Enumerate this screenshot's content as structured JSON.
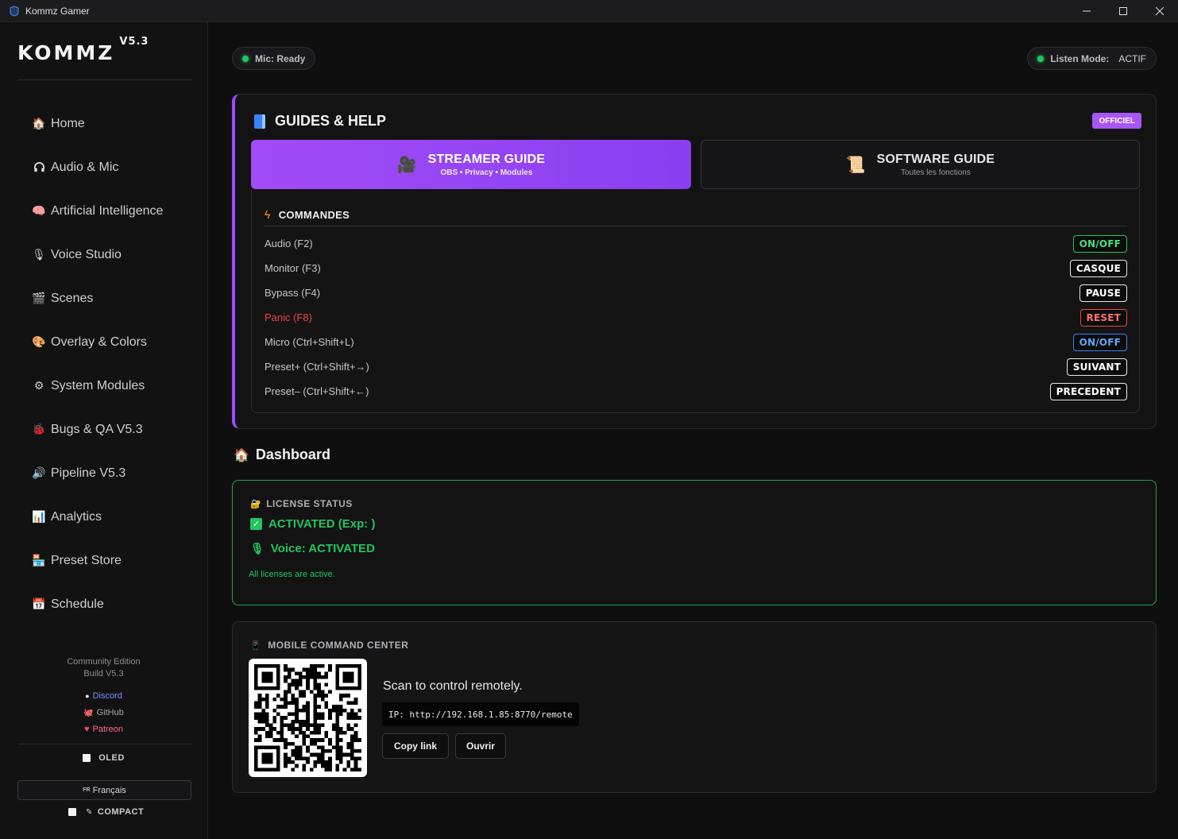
{
  "window": {
    "title": "Kommz Gamer",
    "controls": [
      "minimize",
      "maximize",
      "close"
    ]
  },
  "sidebar": {
    "brand": "KOMMZ",
    "version": "V5.3",
    "items": [
      {
        "label": "Home",
        "icon": "house-icon"
      },
      {
        "label": "Audio & Mic",
        "icon": "headphones-icon"
      },
      {
        "label": "Artificial Intelligence",
        "icon": "brain-icon"
      },
      {
        "label": "Voice Studio",
        "icon": "microphone-icon"
      },
      {
        "label": "Scenes",
        "icon": "clapperboard-icon"
      },
      {
        "label": "Overlay & Colors",
        "icon": "palette-icon"
      },
      {
        "label": "System Modules",
        "icon": "gear-icon"
      },
      {
        "label": "Bugs & QA V5.3",
        "icon": "bug-icon"
      },
      {
        "label": "Pipeline V5.3",
        "icon": "speaker-icon"
      },
      {
        "label": "Analytics",
        "icon": "bar-chart-icon"
      },
      {
        "label": "Preset Store",
        "icon": "store-icon"
      },
      {
        "label": "Schedule",
        "icon": "calendar-icon"
      }
    ],
    "edition": "Community Edition",
    "build": "Build V5.3",
    "links": {
      "discord": "Discord",
      "github": "GitHub",
      "patreon": "Patreon"
    },
    "oled_label": "OLED",
    "language": {
      "flag": "FR",
      "label": "Français"
    },
    "compact_label": "COMPACT"
  },
  "status": {
    "mic_label": "Mic: Ready",
    "listen_label": "Listen Mode:",
    "listen_value": "ACTIF"
  },
  "guides": {
    "title": "GUIDES & HELP",
    "badge": "OFFICIEL",
    "tabs": [
      {
        "label": "STREAMER GUIDE",
        "sub": "OBS • Privacy • Modules",
        "active": true
      },
      {
        "label": "SOFTWARE GUIDE",
        "sub": "Toutes les fonctions",
        "active": false
      }
    ],
    "commands_title": "COMMANDES",
    "commands": [
      {
        "label": "Audio (F2)",
        "key": "ON/OFF",
        "style": "green"
      },
      {
        "label": "Monitor (F3)",
        "key": "CASQUE",
        "style": "white"
      },
      {
        "label": "Bypass (F4)",
        "key": "PAUSE",
        "style": "white"
      },
      {
        "label": "Panic (F8)",
        "key": "RESET",
        "style": "red"
      },
      {
        "label": "Micro (Ctrl+Shift+L)",
        "key": "ON/OFF",
        "style": "blue"
      },
      {
        "label": "Preset+ (Ctrl+Shift+→)",
        "key": "SUIVANT",
        "style": "white"
      },
      {
        "label": "Preset– (Ctrl+Shift+←)",
        "key": "PRECEDENT",
        "style": "white"
      }
    ]
  },
  "dashboard": {
    "title": "Dashboard",
    "license": {
      "header": "LICENSE STATUS",
      "activated": "ACTIVATED (Exp: )",
      "voice": "Voice: ACTIVATED",
      "note": "All licenses are active."
    },
    "mobile": {
      "header": "MOBILE COMMAND CENTER",
      "scan_text": "Scan to control remotely.",
      "ip": "IP: http://192.168.1.85:8770/remote",
      "copy_label": "Copy link",
      "open_label": "Ouvrir"
    }
  },
  "colors": {
    "accent": "#9b4dff",
    "success": "#22c55e",
    "danger": "#ef4444",
    "info": "#3b82f6"
  }
}
